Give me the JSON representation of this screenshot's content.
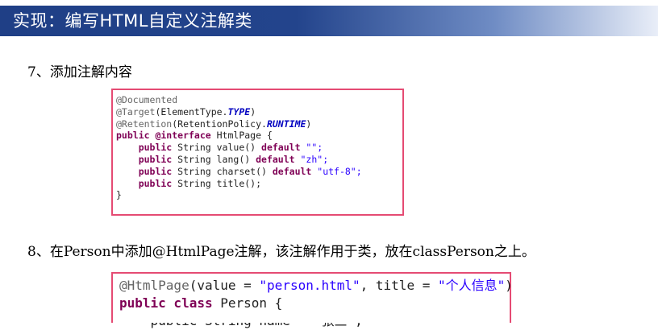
{
  "title": "实现：编写HTML自定义注解类",
  "step7": "7、添加注解内容",
  "step8": "8、在Person中添加@HtmlPage注解，该注解作用于类，放在classPerson之上。",
  "code1": {
    "l1": "@Documented",
    "l2a": "@Target",
    "l2b": "(ElementType.",
    "l2c": "TYPE",
    "l2d": ")",
    "l3a": "@Retention",
    "l3b": "(RetentionPolicy.",
    "l3c": "RUNTIME",
    "l3d": ")",
    "l4a": "public @interface",
    "l4b": " HtmlPage {",
    "l5a": "    public",
    "l5b": " String value() ",
    "l5c": "default",
    "l5d": " \"\";",
    "l6a": "    public",
    "l6b": " String lang() ",
    "l6c": "default",
    "l6d": " \"zh\";",
    "l7a": "    public",
    "l7b": " String charset() ",
    "l7c": "default",
    "l7d": " \"utf-8\";",
    "l8a": "    public",
    "l8b": " String title();",
    "l9": "}"
  },
  "code2": {
    "l1a": "@HtmlPage",
    "l1b": "(value = ",
    "l1c": "\"person.html\"",
    "l1d": ", title = ",
    "l1e": "\"个人信息\"",
    "l1f": ")",
    "l2a": "public class",
    "l2b": " Person {",
    "l3": "    public String name = \"张三\";"
  },
  "colors": {
    "title_bar": "#1f3f86",
    "code_border": "#e54b73",
    "keyword": "#7f0055",
    "string": "#2a00ff"
  }
}
